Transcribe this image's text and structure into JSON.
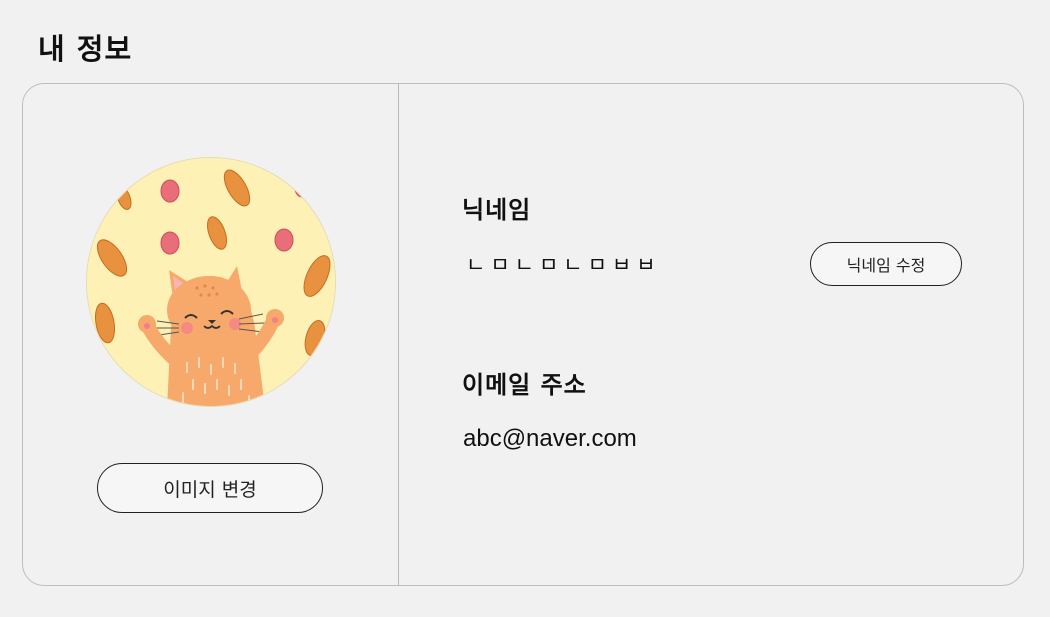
{
  "page": {
    "title": "내 정보"
  },
  "profile": {
    "image_alt": "cat-with-leaves-avatar",
    "change_image_label": "이미지 변경"
  },
  "nickname": {
    "label": "닉네임",
    "value": "ㄴㅁㄴㅁㄴㅁㅂㅂ",
    "edit_label": "닉네임 수정"
  },
  "email": {
    "label": "이메일 주소",
    "value": "abc@naver.com"
  },
  "colors": {
    "background": "#f1f1f1",
    "border": "#bdbdbd",
    "avatar_bg": "#fdf1b6",
    "cat": "#f6a96a",
    "leaf_orange": "#e8923f",
    "leaf_pink": "#e86f7a"
  }
}
